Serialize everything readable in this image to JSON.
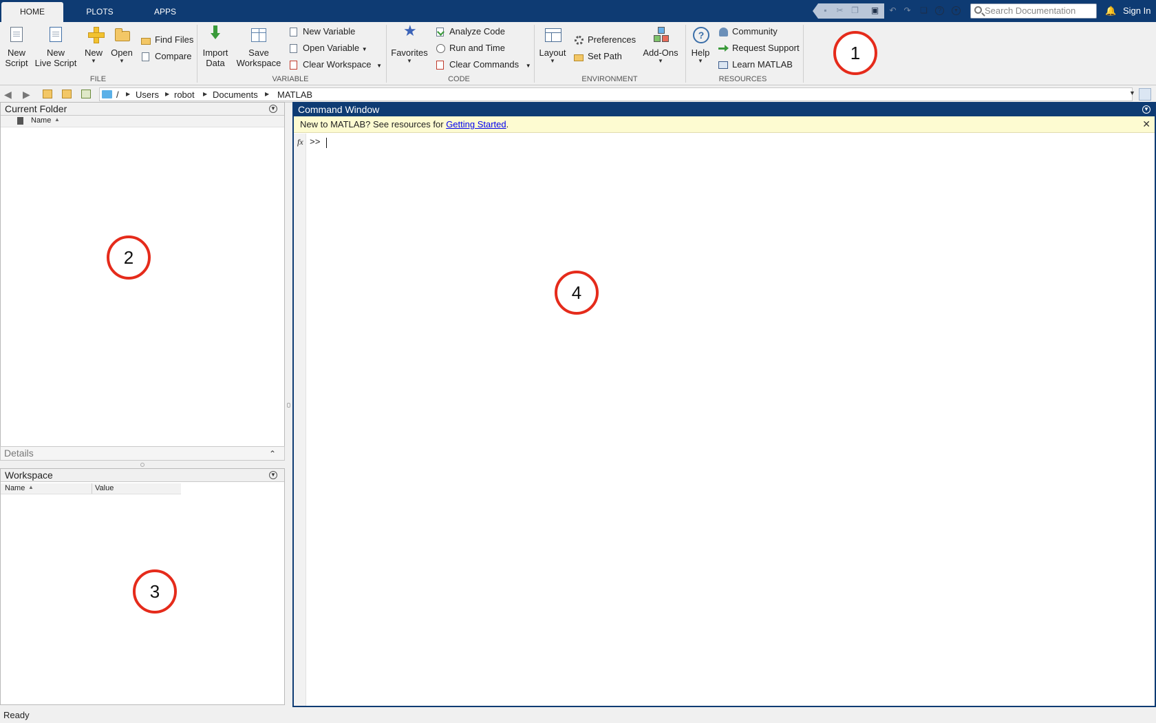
{
  "tabs": [
    "HOME",
    "PLOTS",
    "APPS"
  ],
  "search_placeholder": "Search Documentation",
  "sign_in": "Sign In",
  "ribbon": {
    "file": {
      "label": "FILE",
      "new_script": [
        "New",
        "Script"
      ],
      "new_live_script": [
        "New",
        "Live Script"
      ],
      "new": "New",
      "open": "Open",
      "find_files": "Find Files",
      "compare": "Compare"
    },
    "variable": {
      "label": "VARIABLE",
      "import_data": [
        "Import",
        "Data"
      ],
      "save_workspace": [
        "Save",
        "Workspace"
      ],
      "new_variable": "New Variable",
      "open_variable": "Open Variable",
      "clear_workspace": "Clear Workspace"
    },
    "code": {
      "label": "CODE",
      "favorites": "Favorites",
      "analyze_code": "Analyze Code",
      "run_and_time": "Run and Time",
      "clear_commands": "Clear Commands"
    },
    "environment": {
      "label": "ENVIRONMENT",
      "layout": "Layout",
      "preferences": "Preferences",
      "set_path": "Set Path",
      "add_ons": "Add-Ons"
    },
    "resources": {
      "label": "RESOURCES",
      "help": "Help",
      "community": "Community",
      "request_support": "Request Support",
      "learn_matlab": "Learn MATLAB"
    }
  },
  "path": [
    "/",
    "Users",
    "robot",
    "Documents",
    "MATLAB"
  ],
  "current_folder": {
    "title": "Current Folder",
    "column_name": "Name"
  },
  "details": {
    "title": "Details"
  },
  "workspace": {
    "title": "Workspace",
    "columns": [
      "Name",
      "Value"
    ]
  },
  "command_window": {
    "title": "Command Window",
    "banner_text": "New to MATLAB? See resources for ",
    "banner_link": "Getting Started",
    "banner_end": ".",
    "fx": "fx",
    "prompt": ">>"
  },
  "status": "Ready",
  "callouts": [
    "1",
    "2",
    "3",
    "4"
  ],
  "colors": {
    "title_bar": "#0e3b73",
    "banner_bg": "#fdfbd1",
    "callout_ring": "#e52b1b",
    "link": "#0000ee"
  },
  "icons": [
    "search-icon",
    "bell-icon",
    "save-icon",
    "cut-icon",
    "copy-icon",
    "paste-icon",
    "undo-icon",
    "redo-icon",
    "switch-windows-icon",
    "help-icon",
    "dropdown-icon"
  ]
}
